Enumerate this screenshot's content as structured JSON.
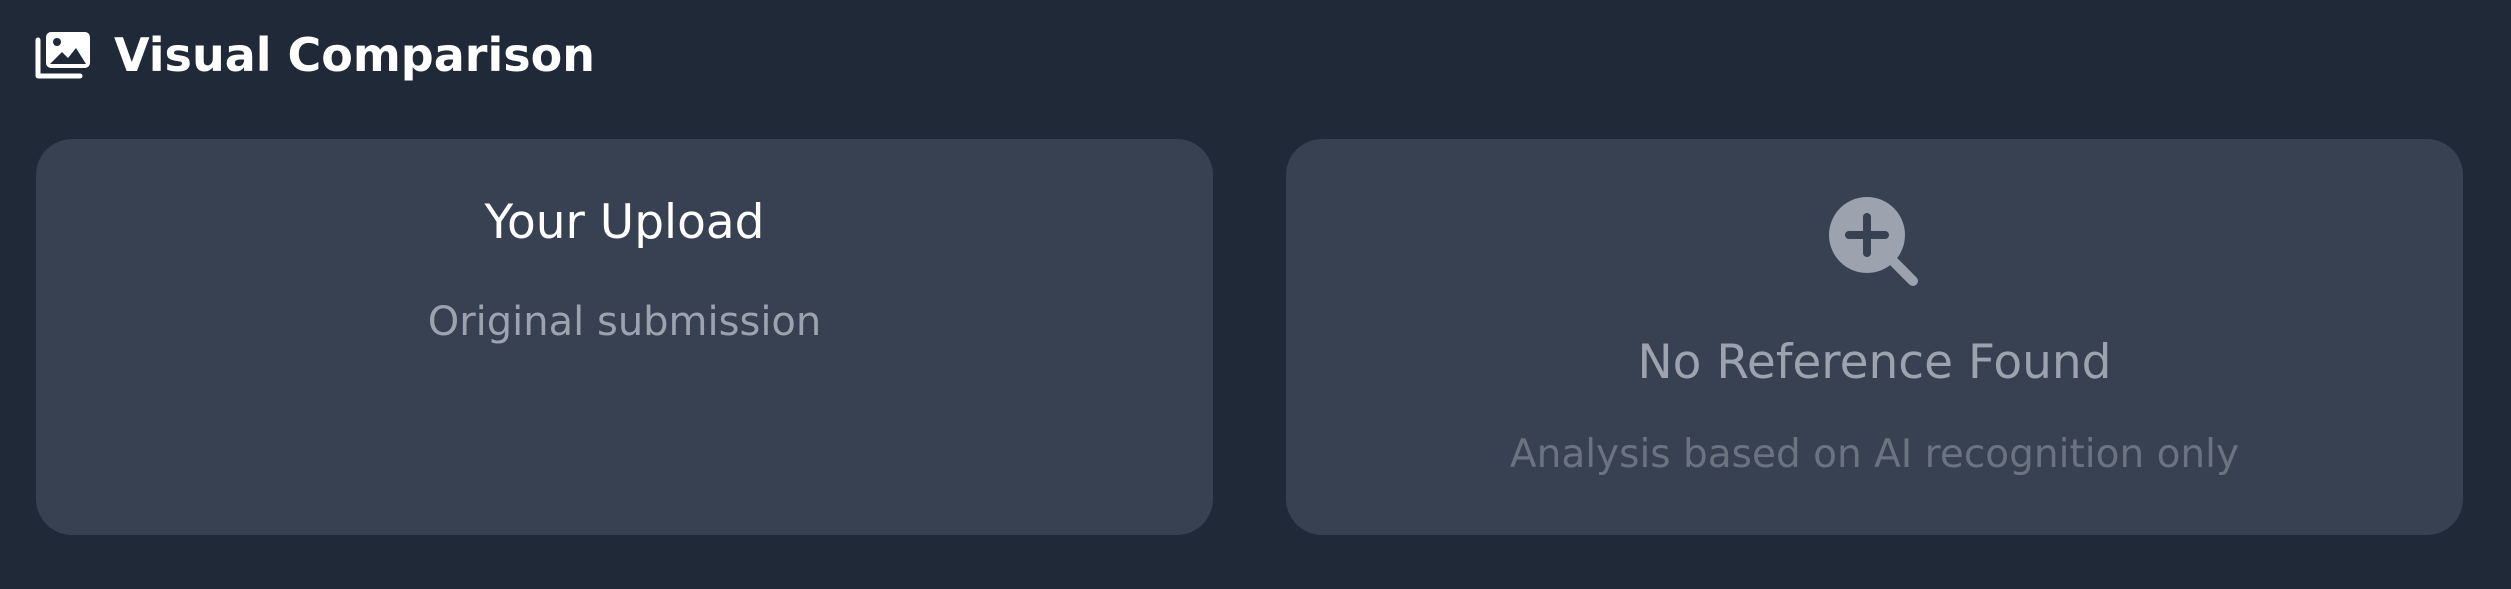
{
  "header": {
    "icon": "images-icon",
    "title": "Visual Comparison"
  },
  "upload_card": {
    "title": "Your Upload",
    "subtitle": "Original submission"
  },
  "reference_card": {
    "icon": "search-plus-icon",
    "title": "No Reference Found",
    "subtitle": "Analysis based on AI recognition only"
  },
  "colors": {
    "background": "#1f2937",
    "card": "#374151",
    "title_text": "#ffffff",
    "muted_text": "#9ca3af",
    "faint_text": "#6b7280"
  }
}
